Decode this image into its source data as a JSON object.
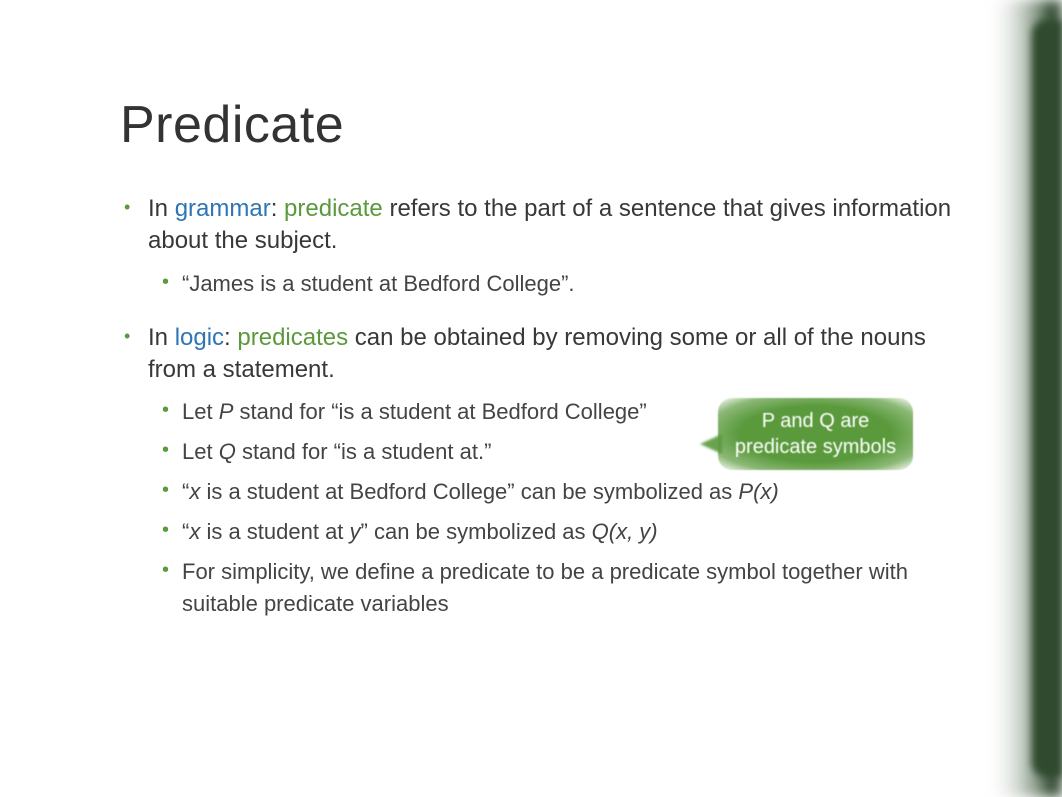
{
  "title": "Predicate",
  "bullets": [
    {
      "prefix": "In ",
      "kw1": "grammar",
      "sep1": ": ",
      "kw2": "predicate",
      "rest": " refers to the part of a sentence that gives information about the subject.",
      "sub": [
        {
          "text": "“James is a student at Bedford College”."
        }
      ]
    },
    {
      "prefix": "In ",
      "kw1": "logic",
      "sep1": ": ",
      "kw2": "predicates",
      "rest": " can be obtained by removing some or all of the nouns from a statement.",
      "sub": [
        {
          "pre": "Let ",
          "it1": "P",
          "post": " stand for “is a student at Bedford College”"
        },
        {
          "pre": "Let ",
          "it1": "Q",
          "post": " stand for “is a student at.”"
        },
        {
          "pre": "“",
          "it1": "x",
          "mid": " is a student at Bedford College” can be symbolized as ",
          "it2": "P(x)"
        },
        {
          "pre": "“",
          "it1": "x",
          "mid": " is a student at ",
          "it1b": "y",
          "mid2": "” can be symbolized as ",
          "it2": "Q(x, y)"
        },
        {
          "text": "For simplicity, we define a predicate to be a predicate symbol together with suitable predicate variables"
        }
      ]
    }
  ],
  "callout": {
    "line1": "P and Q are",
    "line2": "predicate symbols"
  }
}
